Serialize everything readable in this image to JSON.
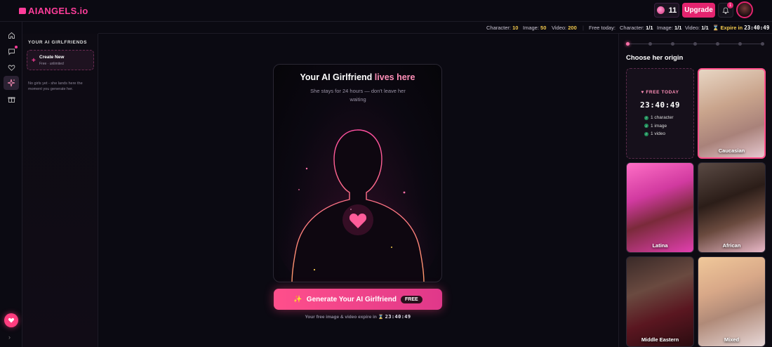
{
  "header": {
    "logo_text": "AIANGELS.io",
    "coins": "11",
    "upgrade_label": "Upgrade",
    "notification_count": "1"
  },
  "rail": {
    "items": [
      "home-icon",
      "chat-icon",
      "heart-icon",
      "sparkle-icon",
      "gift-icon"
    ],
    "active_index": 3
  },
  "girlfriends_panel": {
    "title": "YOUR AI GIRLFRIENDS",
    "create_title": "Create New",
    "create_subtitle": "Free · unlimited",
    "empty_note": "No girls yet - she lands here the moment you generate her."
  },
  "infobar": {
    "character_label": "Character:",
    "character_value": "10",
    "image_label": "Image:",
    "image_value": "50",
    "video_label": "Video:",
    "video_value": "200",
    "free_today_label": "Free today:",
    "free_character_label": "Character:",
    "free_character_value": "1/1",
    "free_image_label": "Image:",
    "free_image_value": "1/1",
    "free_video_label": "Video:",
    "free_video_value": "1/1",
    "expire_label": "Expire in",
    "expire_timer": "23:40:49"
  },
  "preview_card": {
    "title_main": "Your AI Girlfriend",
    "title_accent": "lives here",
    "subtitle": "She stays for 24 hours — don't leave her waiting"
  },
  "generate": {
    "button_label": "Generate Your AI Girlfriend",
    "free_badge": "FREE",
    "expire_note_text": "Your free image & video expire in",
    "expire_timer": "23:40:49"
  },
  "origin": {
    "title": "Choose her origin",
    "step_count": 7,
    "active_step": 0,
    "free_tile": {
      "heading": "FREE TODAY",
      "timer": "23:40:49",
      "perks": [
        "1 character",
        "1 image",
        "1 video"
      ]
    },
    "options": [
      {
        "label": "Caucasian",
        "selected": true
      },
      {
        "label": "Latina",
        "selected": false
      },
      {
        "label": "African",
        "selected": false
      },
      {
        "label": "Middle Eastern",
        "selected": false
      },
      {
        "label": "Mixed",
        "selected": false
      }
    ]
  },
  "colors": {
    "accent": "#ff3d9a",
    "button": "#e4246f",
    "gold": "#f2c94c",
    "background": "#0b0a12"
  }
}
